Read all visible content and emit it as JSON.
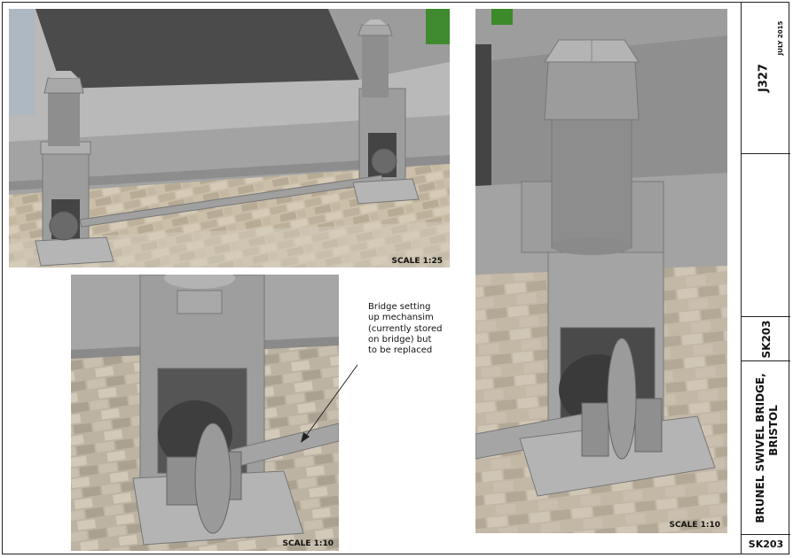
{
  "views": {
    "top_left": {
      "scale": "SCALE 1:25"
    },
    "bottom_left": {
      "scale": "SCALE 1:10"
    },
    "right": {
      "scale": "SCALE 1:10"
    }
  },
  "annotation": {
    "lines": [
      "Bridge setting",
      "up mechansim",
      "(currently stored",
      "on bridge) but",
      "to be replaced"
    ]
  },
  "title_block": {
    "job_number": "J327",
    "date": "JULY 2015",
    "drawing_number": "SK203",
    "title_line1": "BRUNEL SWIVEL BRIDGE,",
    "title_line2": "BRISTOL",
    "sheet_number": "SK203"
  },
  "colors": {
    "stone": "#9a9a9a",
    "paving": "#c9bfae",
    "asphalt": "#4a4a4a",
    "grass": "#3c8a2a",
    "concrete": "#a9a9a9"
  }
}
